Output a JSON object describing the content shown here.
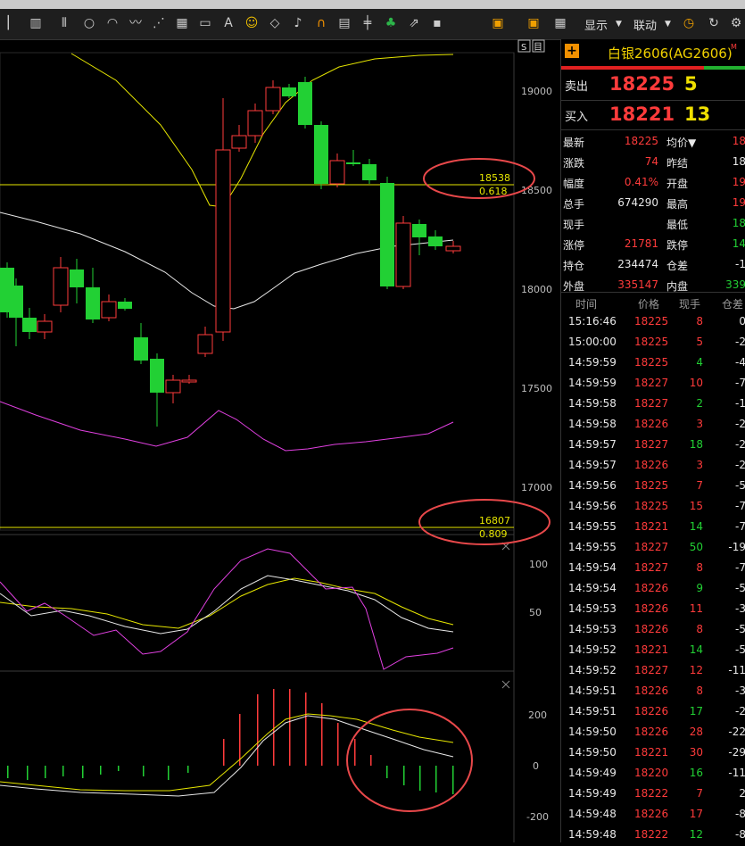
{
  "toolbar": {
    "display_label": "显示",
    "link_label": "联动"
  },
  "price_axis": {
    "ticks": [
      "19000",
      "18500",
      "18000",
      "17500",
      "17000"
    ]
  },
  "fib_lines": [
    {
      "price": "18538",
      "ratio": "0.618"
    },
    {
      "price": "16807",
      "ratio": "0.809"
    }
  ],
  "kdj_axis": {
    "ticks": [
      "100",
      "50"
    ]
  },
  "macd_axis": {
    "ticks": [
      "200",
      "0",
      "-200"
    ]
  },
  "header_buttons": {
    "s1": "S",
    "s2": "目"
  },
  "quote": {
    "contract": "白银2606(AG2606)",
    "contract_mark": "M",
    "sell_label": "卖出",
    "sell_price": "18225",
    "sell_vol": "5",
    "buy_label": "买入",
    "buy_price": "18221",
    "buy_vol": "13",
    "rows": [
      {
        "l1": "最新",
        "v1": "18225",
        "c1": "red",
        "l2": "均价▼",
        "v2": "18",
        "c2": "red"
      },
      {
        "l1": "涨跌",
        "v1": "74",
        "c1": "red",
        "l2": "昨结",
        "v2": "18",
        "c2": "white"
      },
      {
        "l1": "幅度",
        "v1": "0.41%",
        "c1": "red",
        "l2": "开盘",
        "v2": "19",
        "c2": "red"
      },
      {
        "l1": "总手",
        "v1": "674290",
        "c1": "white",
        "l2": "最高",
        "v2": "19",
        "c2": "red"
      },
      {
        "l1": "现手",
        "v1": "",
        "c1": "white",
        "l2": "最低",
        "v2": "18",
        "c2": "green"
      },
      {
        "l1": "涨停",
        "v1": "21781",
        "c1": "red",
        "l2": "跌停",
        "v2": "14",
        "c2": "green"
      },
      {
        "l1": "持仓",
        "v1": "234474",
        "c1": "white",
        "l2": "仓差",
        "v2": "-1",
        "c2": "white"
      },
      {
        "l1": "外盘",
        "v1": "335147",
        "c1": "red",
        "l2": "内盘",
        "v2": "339",
        "c2": "green"
      }
    ]
  },
  "ticks_header": {
    "time": "时间",
    "price": "价格",
    "vol": "现手",
    "oi": "仓差"
  },
  "ticks": [
    {
      "t": "15:16:46",
      "p": "18225",
      "v": "8",
      "oi": "0",
      "vc": "red"
    },
    {
      "t": "15:00:00",
      "p": "18225",
      "v": "5",
      "oi": "-2",
      "vc": "red"
    },
    {
      "t": "14:59:59",
      "p": "18225",
      "v": "4",
      "oi": "-4",
      "vc": "green"
    },
    {
      "t": "14:59:59",
      "p": "18227",
      "v": "10",
      "oi": "-7",
      "vc": "red"
    },
    {
      "t": "14:59:58",
      "p": "18227",
      "v": "2",
      "oi": "-1",
      "vc": "green"
    },
    {
      "t": "14:59:58",
      "p": "18226",
      "v": "3",
      "oi": "-2",
      "vc": "red"
    },
    {
      "t": "14:59:57",
      "p": "18227",
      "v": "18",
      "oi": "-2",
      "vc": "green"
    },
    {
      "t": "14:59:57",
      "p": "18226",
      "v": "3",
      "oi": "-2",
      "vc": "red"
    },
    {
      "t": "14:59:56",
      "p": "18225",
      "v": "7",
      "oi": "-5",
      "vc": "red"
    },
    {
      "t": "14:59:56",
      "p": "18225",
      "v": "15",
      "oi": "-7",
      "vc": "red"
    },
    {
      "t": "14:59:55",
      "p": "18221",
      "v": "14",
      "oi": "-7",
      "vc": "green"
    },
    {
      "t": "14:59:55",
      "p": "18227",
      "v": "50",
      "oi": "-19",
      "vc": "green"
    },
    {
      "t": "14:59:54",
      "p": "18227",
      "v": "8",
      "oi": "-7",
      "vc": "red"
    },
    {
      "t": "14:59:54",
      "p": "18226",
      "v": "9",
      "oi": "-5",
      "vc": "green"
    },
    {
      "t": "14:59:53",
      "p": "18226",
      "v": "11",
      "oi": "-3",
      "vc": "red"
    },
    {
      "t": "14:59:53",
      "p": "18226",
      "v": "8",
      "oi": "-5",
      "vc": "red"
    },
    {
      "t": "14:59:52",
      "p": "18221",
      "v": "14",
      "oi": "-5",
      "vc": "green"
    },
    {
      "t": "14:59:52",
      "p": "18227",
      "v": "12",
      "oi": "-11",
      "vc": "red"
    },
    {
      "t": "14:59:51",
      "p": "18226",
      "v": "8",
      "oi": "-3",
      "vc": "red"
    },
    {
      "t": "14:59:51",
      "p": "18226",
      "v": "17",
      "oi": "-2",
      "vc": "green"
    },
    {
      "t": "14:59:50",
      "p": "18226",
      "v": "28",
      "oi": "-22",
      "vc": "red"
    },
    {
      "t": "14:59:50",
      "p": "18221",
      "v": "30",
      "oi": "-29",
      "vc": "red"
    },
    {
      "t": "14:59:49",
      "p": "18220",
      "v": "16",
      "oi": "-11",
      "vc": "green"
    },
    {
      "t": "14:59:49",
      "p": "18222",
      "v": "7",
      "oi": "2",
      "vc": "red"
    },
    {
      "t": "14:59:48",
      "p": "18226",
      "v": "17",
      "oi": "-8",
      "vc": "red"
    },
    {
      "t": "14:59:48",
      "p": "18222",
      "v": "12",
      "oi": "-8",
      "vc": "green"
    }
  ],
  "colors": {
    "up": "#ff3b3b",
    "down": "#22d034",
    "ma_yellow": "#e6e600",
    "ma_white": "#e8e8e8",
    "ma_magenta": "#e040e0",
    "circle": "#e8484a"
  }
}
